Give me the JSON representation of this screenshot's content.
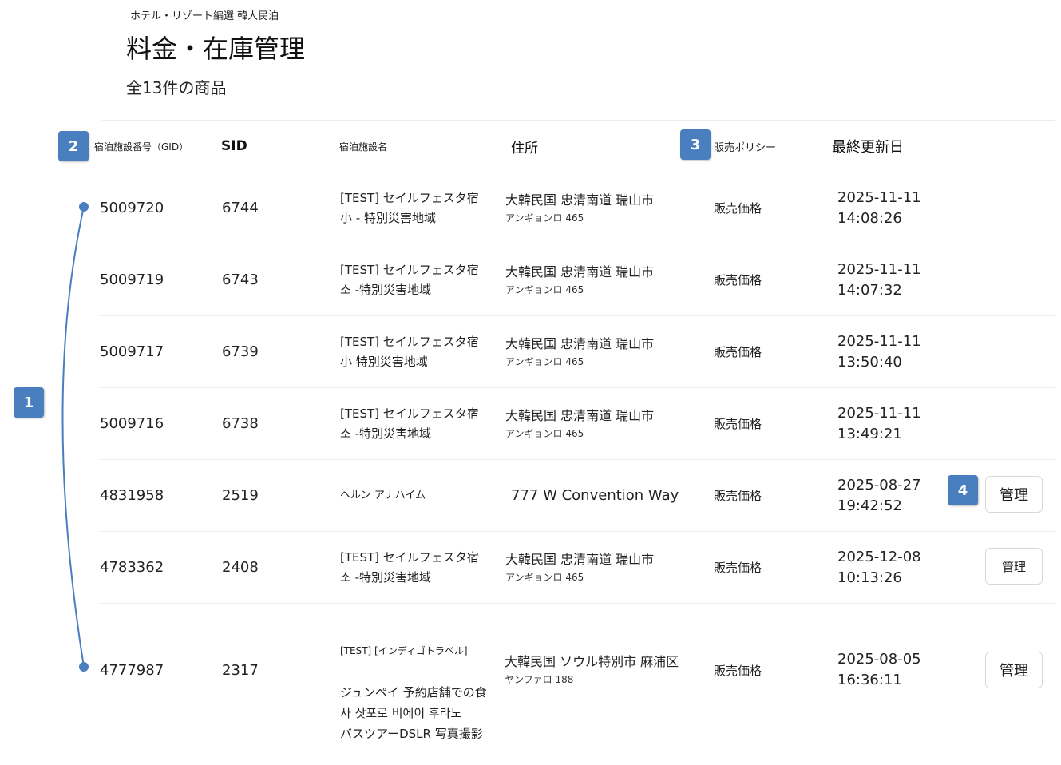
{
  "header": {
    "breadcrumb": "ホテル・リゾート編選 韓人民泊",
    "title": "料金・在庫管理",
    "subtitle": "全13件の商品"
  },
  "table": {
    "columns": {
      "gid": "宿泊施設番号（GID）",
      "sid": "SID",
      "name": "宿泊施設名",
      "address": "住所",
      "policy": "販売ポリシー",
      "updated": "最終更新日"
    },
    "rows": [
      {
        "gid": "5009720",
        "sid": "6744",
        "name": "[TEST] セイルフェスタ宿\n小 - 特別災害地域",
        "addr1": "大韓民国 忠清南道 瑞山市",
        "addr2": "アンギョンロ 465",
        "policy": "販売価格",
        "updated": "2025-11-11\n14:08:26",
        "manage": ""
      },
      {
        "gid": "5009719",
        "sid": "6743",
        "name": "[TEST] セイルフェスタ宿\n 소 -特別災害地域",
        "addr1": "大韓民国 忠清南道 瑞山市",
        "addr2": "アンギョンロ 465",
        "policy": "販売価格",
        "updated": "2025-11-11\n14:07:32",
        "manage": ""
      },
      {
        "gid": "5009717",
        "sid": "6739",
        "name": "[TEST] セイルフェスタ宿\n 小  特別災害地域",
        "addr1": "大韓民国 忠清南道 瑞山市",
        "addr2": "アンギョンロ 465",
        "policy": "販売価格",
        "updated": "2025-11-11\n13:50:40",
        "manage": ""
      },
      {
        "gid": "5009716",
        "sid": "6738",
        "name": "[TEST] セイルフェスタ宿\n 소 -特別災害地域",
        "addr1": "大韓民国 忠清南道 瑞山市",
        "addr2": "アンギョンロ 465",
        "policy": "販売価格",
        "updated": "2025-11-11\n13:49:21",
        "manage": ""
      },
      {
        "gid": "4831958",
        "sid": "2519",
        "name": "ヘルン アナハイム",
        "addr1": "777 W Convention Way",
        "addr2": "",
        "policy": "販売価格",
        "updated": "2025-08-27\n19:42:52",
        "manage": "管理"
      },
      {
        "gid": "4783362",
        "sid": "2408",
        "name": "[TEST] セイルフェスタ宿\n 소 -特別災害地域",
        "addr1": "大韓民国 忠清南道 瑞山市",
        "addr2": "アンギョンロ 465",
        "policy": "販売価格",
        "updated": "2025-12-08\n10:13:26",
        "manage": "管理"
      },
      {
        "gid": "4777987",
        "sid": "2317",
        "name_line1": "[TEST] [インディゴトラベル]",
        "name_rest": "ジュンペイ 予約店舗での食\n 사 삿포로 비에이 후라노\nバスツアーDSLR 写真撮影",
        "addr1": "大韓民国 ソウル特別市 麻浦区",
        "addr2": "ヤンファロ 188",
        "policy": "販売価格",
        "updated": "2025-08-05\n16:36:11",
        "manage": "管理"
      }
    ]
  },
  "markers": [
    "1",
    "2",
    "3",
    "4"
  ],
  "colors": {
    "marker": "#4a7fbf",
    "bracket": "#4a7fbf"
  }
}
